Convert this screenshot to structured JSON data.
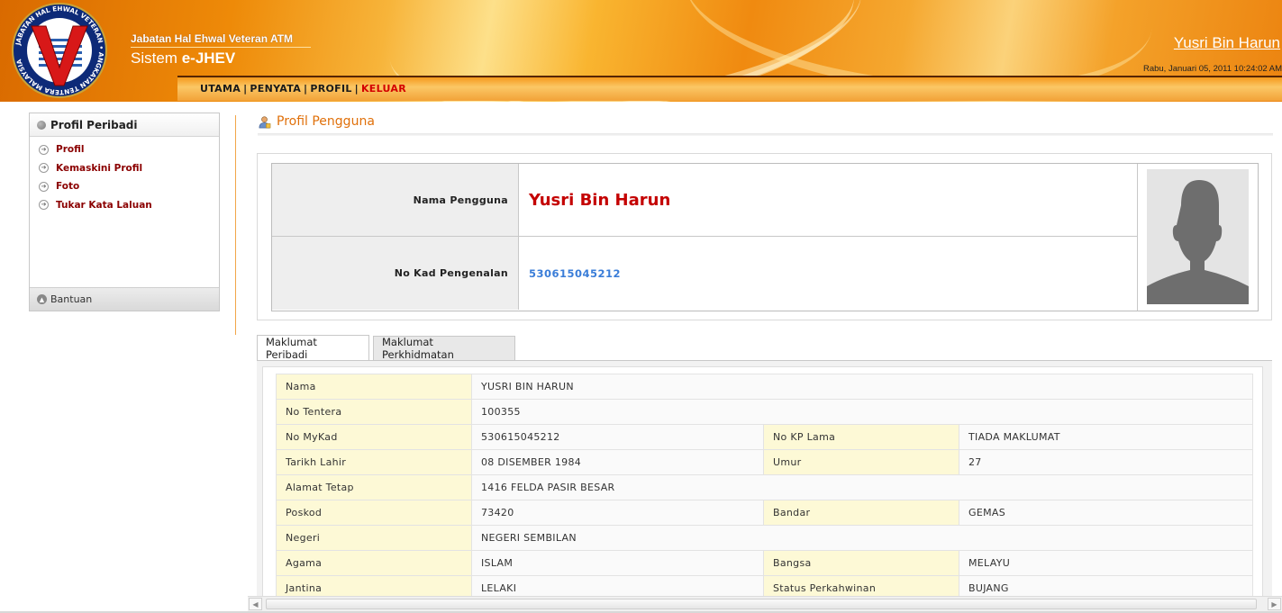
{
  "header": {
    "org_name": "Jabatan Hal Ehwal Veteran ATM",
    "system_prefix": "Sistem",
    "system_name": "e-JHEV",
    "user_name": "Yusri Bin Harun",
    "datetime": "Rabu, Januari 05, 2011 10:24:02 AM",
    "logo_text": "JABATAN HAL EHWAL VETERAN • ANGKATAN TENTERA MALAYSIA",
    "logo_letter": "V"
  },
  "nav": {
    "items": [
      "UTAMA",
      "PENYATA",
      "PROFIL",
      "KELUAR"
    ],
    "sep1": "|",
    "sep2": "|",
    "sep3": "|"
  },
  "sidebar": {
    "title": "Profil Peribadi",
    "items": [
      {
        "label": "Profil"
      },
      {
        "label": "Kemaskini Profil"
      },
      {
        "label": "Foto"
      },
      {
        "label": "Tukar Kata Laluan"
      }
    ],
    "footer": "Bantuan"
  },
  "main": {
    "title": "Profil Pengguna",
    "card": {
      "name_label": "Nama Pengguna",
      "name_value": "Yusri Bin Harun",
      "ic_label": "No Kad Pengenalan",
      "ic_value": "530615045212"
    },
    "tabs": [
      {
        "label": "Maklumat Peribadi",
        "active": true
      },
      {
        "label": "Maklumat Perkhidmatan",
        "active": false
      }
    ],
    "details": {
      "nama_l": "Nama",
      "nama_v": "YUSRI BIN HARUN",
      "tentera_l": "No Tentera",
      "tentera_v": "100355",
      "mykad_l": "No MyKad",
      "mykad_v": "530615045212",
      "kplama_l": "No KP Lama",
      "kplama_v": "TIADA MAKLUMAT",
      "lahir_l": "Tarikh Lahir",
      "lahir_v": "08 DISEMBER 1984",
      "umur_l": "Umur",
      "umur_v": "27",
      "alamat_l": "Alamat Tetap",
      "alamat_v": "1416 FELDA PASIR BESAR",
      "poskod_l": "Poskod",
      "poskod_v": "73420",
      "bandar_l": "Bandar",
      "bandar_v": "GEMAS",
      "negeri_l": "Negeri",
      "negeri_v": "NEGERI SEMBILAN",
      "agama_l": "Agama",
      "agama_v": "ISLAM",
      "bangsa_l": "Bangsa",
      "bangsa_v": "MELAYU",
      "jantina_l": "Jantina",
      "jantina_v": "LELAKI",
      "kahwin_l": "Status Perkahwinan",
      "kahwin_v": "BUJANG"
    }
  },
  "colors": {
    "accent_orange": "#e0700a",
    "name_red": "#c40000",
    "ic_blue": "#3a7dd8",
    "sidebar_link": "#8b0000",
    "label_bg": "#fdf9d6"
  }
}
